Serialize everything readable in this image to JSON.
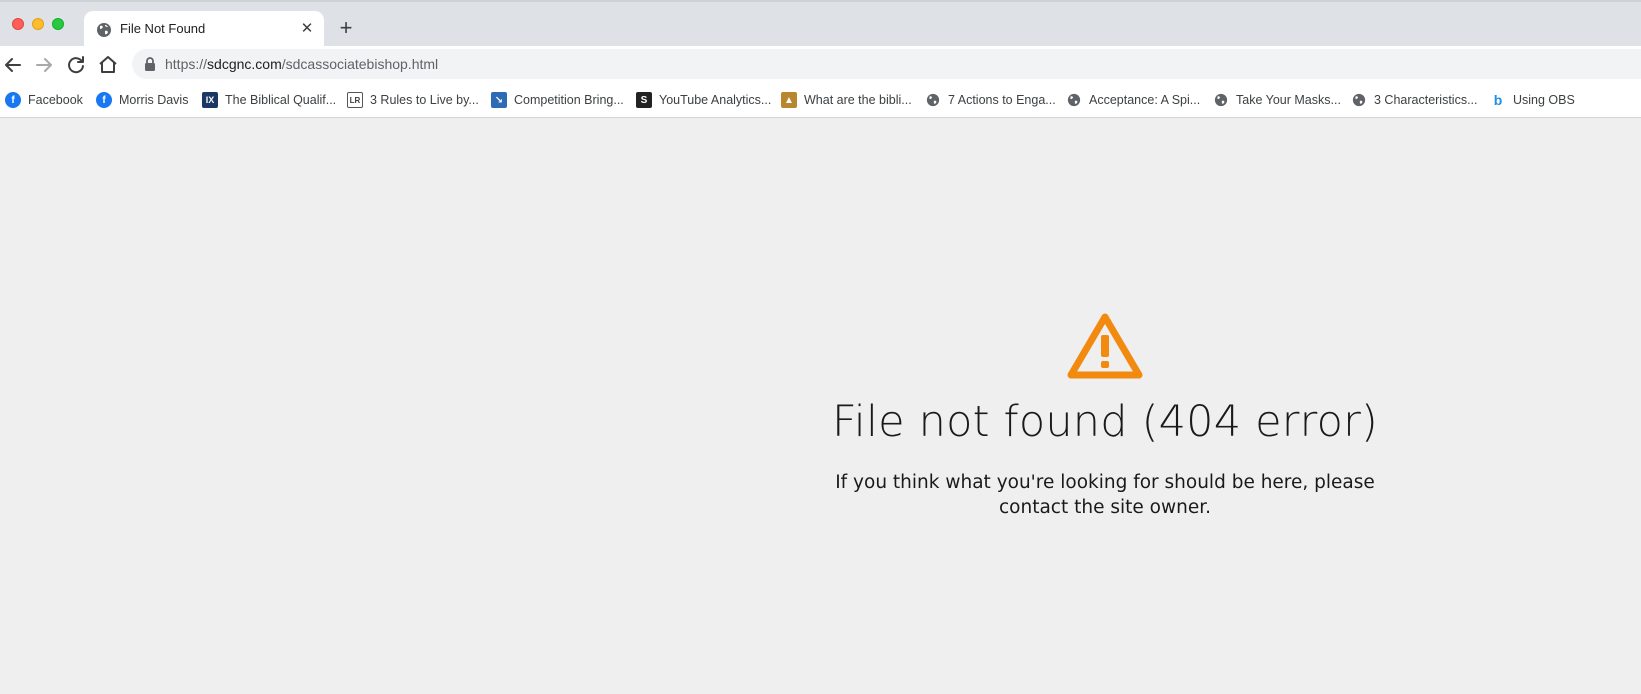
{
  "browser": {
    "tab": {
      "title": "File Not Found",
      "close_glyph": "✕",
      "favicon": "globe-icon"
    },
    "new_tab_glyph": "+",
    "toolbar": {
      "back_icon": "arrow-left-icon",
      "forward_icon": "arrow-right-icon",
      "reload_icon": "reload-icon",
      "home_icon": "home-icon"
    },
    "address": {
      "scheme": "https://",
      "host": "sdcgnc.com",
      "path": "/sdcassociatebishop.html",
      "lock_icon": "lock-icon"
    },
    "bookmarks": [
      {
        "label": "Facebook",
        "icon": "facebook-icon"
      },
      {
        "label": "Morris Davis",
        "icon": "facebook-icon"
      },
      {
        "label": "The Biblical Qualif...",
        "icon": "ix-icon"
      },
      {
        "label": "3 Rules to Live by...",
        "icon": "book-icon"
      },
      {
        "label": "Competition Bring...",
        "icon": "arrow-icon"
      },
      {
        "label": "YouTube Analytics...",
        "icon": "s-icon"
      },
      {
        "label": "What are the bibli...",
        "icon": "image-icon"
      },
      {
        "label": "7 Actions to Enga...",
        "icon": "globe-icon"
      },
      {
        "label": "Acceptance: A Spi...",
        "icon": "globe-icon"
      },
      {
        "label": "Take Your Masks...",
        "icon": "globe-icon"
      },
      {
        "label": "3 Characteristics...",
        "icon": "globe-icon"
      },
      {
        "label": "Using OBS",
        "icon": "bing-icon"
      }
    ]
  },
  "page": {
    "warning_icon": "warning-triangle-icon",
    "title": "File not found (404 error)",
    "message": "If you think what you're looking for should be here, please contact the site owner."
  },
  "colors": {
    "warning": "#f28a0f",
    "tabstrip": "#dee1e6",
    "page_background": "#efefef",
    "facebook_blue": "#1877f2"
  }
}
